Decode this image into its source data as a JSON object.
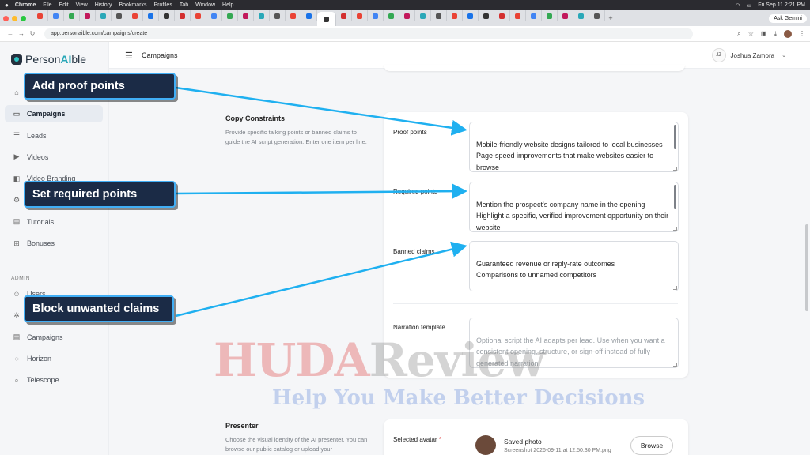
{
  "mac_menu": {
    "apple": "",
    "items": [
      "Chrome",
      "File",
      "Edit",
      "View",
      "History",
      "Bookmarks",
      "Profiles",
      "Tab",
      "Window",
      "Help"
    ],
    "clock": "Fri Sep 11  2:21 PM"
  },
  "browser": {
    "ask_gemini": "Ask Gemini",
    "url": "app.personaible.com/campaigns/create"
  },
  "brand": {
    "prefix": "Person",
    "ai": "AI",
    "suffix": "ble"
  },
  "sidebar": {
    "items": [
      {
        "label": "Home",
        "icon": "home-icon"
      },
      {
        "label": "Campaigns",
        "icon": "folder-icon"
      },
      {
        "label": "Leads",
        "icon": "leads-icon"
      },
      {
        "label": "Videos",
        "icon": "video-icon"
      },
      {
        "label": "Video Branding",
        "icon": "branding-icon"
      },
      {
        "label": "Settings",
        "icon": "gear-icon"
      },
      {
        "label": "Tutorials",
        "icon": "document-icon"
      },
      {
        "label": "Bonuses",
        "icon": "gift-icon"
      }
    ],
    "admin_label": "ADMIN",
    "admin_items": [
      {
        "label": "Users",
        "icon": "users-icon"
      },
      {
        "label": "Settings",
        "icon": "settings-icon"
      },
      {
        "label": "Campaigns",
        "icon": "document-icon"
      },
      {
        "label": "Horizon",
        "icon": "horizon-icon"
      },
      {
        "label": "Telescope",
        "icon": "search-icon"
      }
    ]
  },
  "topbar": {
    "title": "Campaigns",
    "user_initials": "JZ",
    "user_name": "Joshua Zamora"
  },
  "copy_constraints": {
    "title": "Copy Constraints",
    "description": "Provide specific talking points or banned claims to guide the AI script generation. Enter one item per line.",
    "proof_points_label": "Proof points",
    "proof_points_value": "Mobile-friendly website designs tailored to local businesses\nPage-speed improvements that make websites easier to browse",
    "required_points_label": "Required points",
    "required_points_value": "Mention the prospect's company name in the opening\nHighlight a specific, verified improvement opportunity on their website\nExplain how that improvement would help visitors find",
    "banned_claims_label": "Banned claims",
    "banned_claims_value": "Guaranteed revenue or reply-rate outcomes\nComparisons to unnamed competitors",
    "narration_label": "Narration template",
    "narration_placeholder": "Optional script the AI adapts per lead. Use when you want a consistent opening, structure, or sign-off instead of fully generated narration."
  },
  "presenter": {
    "title": "Presenter",
    "description": "Choose the visual identity of the AI presenter. You can browse our public catalog or upload your",
    "selected_avatar_label": "Selected avatar",
    "required_mark": "*",
    "photo_title": "Saved photo",
    "photo_file": "Screenshot 2026-09-11 at 12.50.30 PM.png",
    "browse_label": "Browse"
  },
  "callouts": {
    "proof": "Add proof points",
    "required": "Set required points",
    "banned": "Block unwanted claims"
  },
  "watermark": {
    "brand_red": "HUDA",
    "brand_gray": "Review",
    "tagline": "Help You Make Better Decisions"
  },
  "colors": {
    "callout_bg": "#1b2b46",
    "callout_border": "#41aef5",
    "arrow": "#1fb0f0",
    "accent": "#2aa8b8"
  }
}
